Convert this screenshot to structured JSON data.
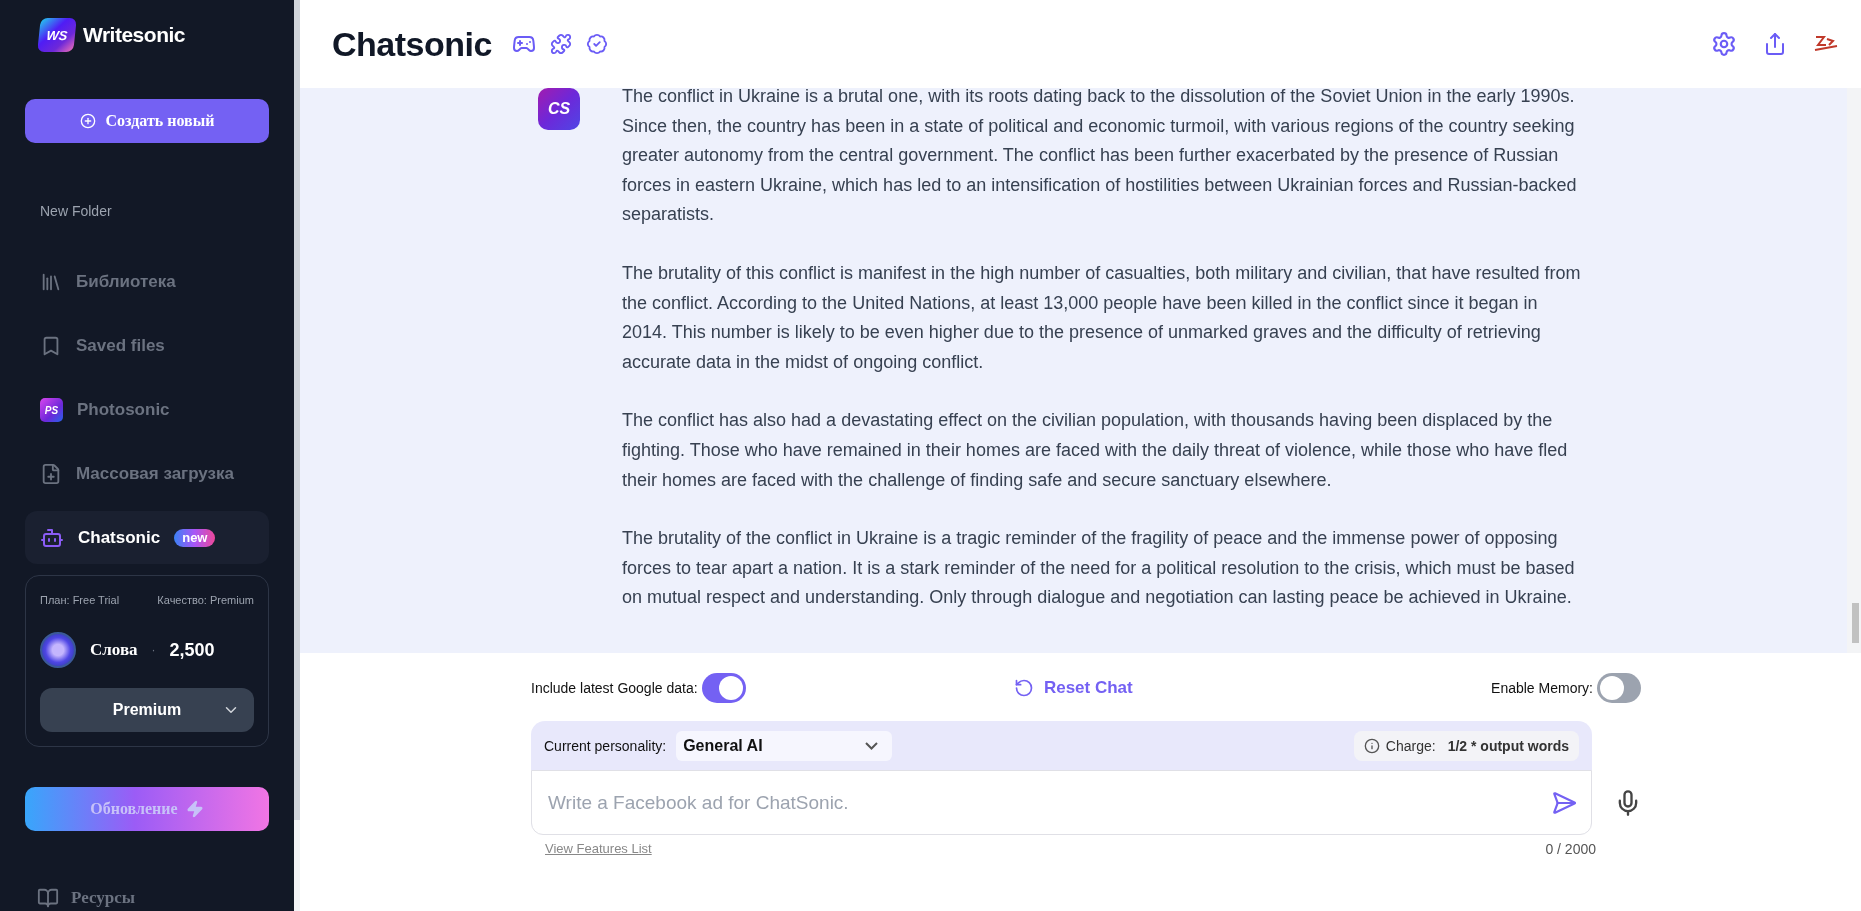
{
  "sidebar": {
    "logo_text": "WS",
    "brand": "Writesonic",
    "create_button": "Создать новый",
    "folder_label": "New Folder",
    "items": [
      {
        "label": "Библиотека",
        "kind": "library",
        "selected": false
      },
      {
        "label": "Saved files",
        "kind": "saved",
        "selected": false
      },
      {
        "label": "Photosonic",
        "kind": "app",
        "icon_text": "PS",
        "selected": false
      },
      {
        "label": "Массовая загрузка",
        "kind": "upload",
        "selected": false
      },
      {
        "label": "Chatsonic",
        "kind": "chat",
        "badge": "new",
        "selected": true
      }
    ],
    "plan": {
      "plan": "План: Free Trial",
      "quality": "Качество: Premium",
      "words_label": "Слова",
      "separator": "·",
      "words": "2,500",
      "tier": "Premium"
    },
    "upgrade_button": "Обновление",
    "resources": "Ресурсы"
  },
  "header": {
    "title": "Chatsonic"
  },
  "messages": [
    {
      "avatar": "CS",
      "paragraphs": [
        "The conflict in Ukraine is a brutal one, with its roots dating back to the dissolution of the Soviet Union in the early 1990s. Since then, the country has been in a state of political and economic turmoil, with various regions of the country seeking greater autonomy from the central government. The conflict has been further exacerbated by the presence of Russian forces in eastern Ukraine, which has led to an intensification of hostilities between Ukrainian forces and Russian-backed separatists.",
        "The brutality of this conflict is manifest in the high number of casualties, both military and civilian, that have resulted from the conflict. According to the United Nations, at least 13,000 people have been killed in the conflict since it began in 2014. This number is likely to be even higher due to the presence of unmarked graves and the difficulty of retrieving accurate data in the midst of ongoing conflict.",
        "The conflict has also had a devastating effect on the civilian population, with thousands having been displaced by the fighting. Those who have remained in their homes are faced with the daily threat of violence, while those who have fled their homes are faced with the challenge of finding safe and secure sanctuary elsewhere.",
        "The brutality of the conflict in Ukraine is a tragic reminder of the fragility of peace and the immense power of opposing forces to tear apart a nation. It is a stark reminder of the need for a political resolution to the crisis, which must be based on mutual respect and understanding. Only through dialogue and negotiation can lasting peace be achieved in Ukraine."
      ]
    }
  ],
  "controls": {
    "google_toggle": {
      "label": "Include latest Google data:",
      "on": true
    },
    "reset": "Reset Chat",
    "memory_toggle": {
      "label": "Enable Memory:",
      "on": false
    }
  },
  "composer": {
    "personality_label": "Current personality:",
    "personality": "General AI",
    "charge_label": "Charge:",
    "charge": "1/2 * output words",
    "placeholder": "Write a Facebook ad for ChatSonic.",
    "features_link": "View Features List",
    "counter": "0 / 2000"
  }
}
